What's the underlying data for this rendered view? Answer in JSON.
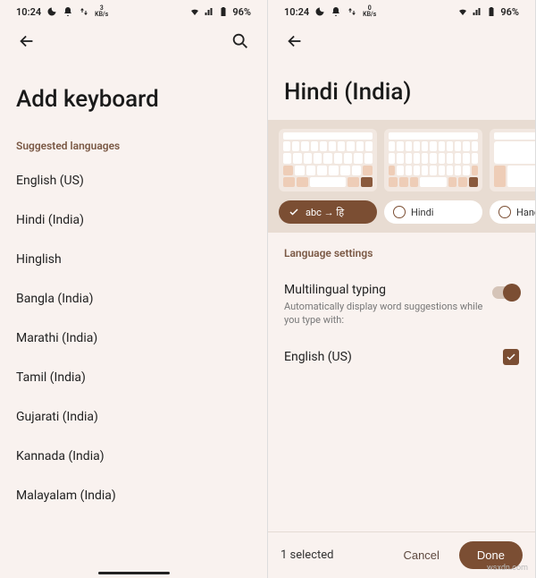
{
  "status": {
    "time": "10:24",
    "net_label_top": "3",
    "net_label_bot": "KB/s",
    "battery": "96%",
    "net_label_top_r": "0",
    "net_label_bot_r": "KB/s"
  },
  "left": {
    "title": "Add keyboard",
    "section": "Suggested languages",
    "languages": [
      "English (US)",
      "Hindi (India)",
      "Hinglish",
      "Bangla (India)",
      "Marathi (India)",
      "Tamil (India)",
      "Gujarati (India)",
      "Kannada (India)",
      "Malayalam (India)"
    ]
  },
  "right": {
    "title": "Hindi (India)",
    "chips": [
      {
        "label": "abc → हि",
        "selected": true
      },
      {
        "label": "Hindi",
        "selected": false
      },
      {
        "label": "Handwriting",
        "selected": false
      }
    ],
    "section": "Language settings",
    "multiling_label": "Multilingual typing",
    "multiling_desc": "Automatically display word suggestions while you type with:",
    "multiling_on": true,
    "lang_check_label": "English (US)",
    "lang_checked": true,
    "footer_count": "1 selected",
    "footer_cancel": "Cancel",
    "footer_done": "Done"
  },
  "watermark": "wsxdn.com"
}
